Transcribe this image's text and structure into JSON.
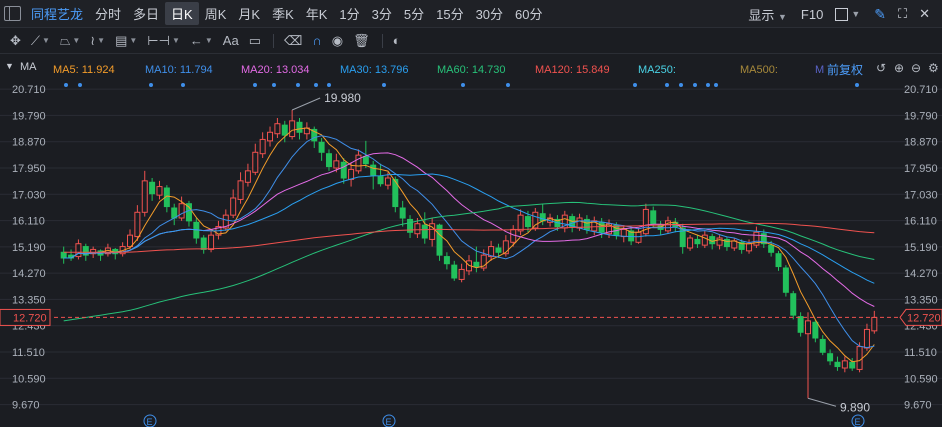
{
  "header": {
    "stock_name": "同程艺龙",
    "tabs": [
      "分时",
      "多日",
      "日K",
      "周K",
      "月K",
      "季K",
      "年K",
      "1分",
      "3分",
      "5分",
      "15分",
      "30分",
      "60分"
    ],
    "active_tab": "日K",
    "display_label": "显示",
    "f10_label": "F10"
  },
  "toolbar": {
    "icons": [
      "crosshair-icon",
      "line-tool-icon",
      "polyline-tool-icon",
      "wave-tool-icon",
      "fibonacci-tool-icon",
      "range-tool-icon",
      "arrow-tool-icon",
      "text-tool-icon",
      "comment-tool-icon",
      "eraser-icon",
      "magnet-icon",
      "eye-icon",
      "trash-icon",
      "toggle-icon"
    ],
    "text_tool": "Aa"
  },
  "ma_legend": {
    "type_label": "MA",
    "items": [
      {
        "label": "MA5: 11.924",
        "color": "#f39c2a"
      },
      {
        "label": "MA10: 11.794",
        "color": "#3f8fea"
      },
      {
        "label": "MA20: 13.034",
        "color": "#e36be6"
      },
      {
        "label": "MA30: 13.796",
        "color": "#2a9ff0"
      },
      {
        "label": "MA60: 14.730",
        "color": "#27c179"
      },
      {
        "label": "MA120: 15.849",
        "color": "#f0524f"
      },
      {
        "label": "MA250:",
        "color": "#4ad3e6"
      },
      {
        "label": "MA500:",
        "color": "#a88a3b"
      },
      {
        "label": "M",
        "color": "#5a63c8"
      }
    ],
    "adjust_label": "前复权"
  },
  "chart_data": {
    "type": "candlestick",
    "y_ticks": [
      20.71,
      19.79,
      18.87,
      17.95,
      17.03,
      16.11,
      15.19,
      14.27,
      13.35,
      12.43,
      11.51,
      10.59,
      9.67
    ],
    "ylim": [
      9.2,
      21.1
    ],
    "grid": true,
    "last_price": "12.720",
    "high_label": "19.980",
    "low_label": "9.890",
    "colors": {
      "up": "#f0524f",
      "down": "#22c05c",
      "last": "#f0524f"
    },
    "candles": [
      [
        15.0,
        14.8,
        15.2,
        14.6
      ],
      [
        14.9,
        14.8,
        15.1,
        14.7
      ],
      [
        14.85,
        15.3,
        15.45,
        14.75
      ],
      [
        15.2,
        14.9,
        15.3,
        14.7
      ],
      [
        14.95,
        15.1,
        15.2,
        14.8
      ],
      [
        15.05,
        14.9,
        15.1,
        14.7
      ],
      [
        14.95,
        15.15,
        15.3,
        14.85
      ],
      [
        15.1,
        14.95,
        15.15,
        14.75
      ],
      [
        14.95,
        15.2,
        15.35,
        14.85
      ],
      [
        15.2,
        15.6,
        15.8,
        15.1
      ],
      [
        15.55,
        16.4,
        16.65,
        15.4
      ],
      [
        16.4,
        17.5,
        17.85,
        16.25
      ],
      [
        17.45,
        17.05,
        17.6,
        16.8
      ],
      [
        17.0,
        17.3,
        17.5,
        16.85
      ],
      [
        17.25,
        16.6,
        17.35,
        16.4
      ],
      [
        16.55,
        16.2,
        16.7,
        15.95
      ],
      [
        16.2,
        16.7,
        16.95,
        16.1
      ],
      [
        16.7,
        16.1,
        16.8,
        15.9
      ],
      [
        16.05,
        15.5,
        16.2,
        15.3
      ],
      [
        15.5,
        15.1,
        15.6,
        14.95
      ],
      [
        15.1,
        15.6,
        15.8,
        15.0
      ],
      [
        15.6,
        15.9,
        16.1,
        15.45
      ],
      [
        15.85,
        16.3,
        16.5,
        15.75
      ],
      [
        16.3,
        16.9,
        17.2,
        16.2
      ],
      [
        16.85,
        17.5,
        17.8,
        16.7
      ],
      [
        17.45,
        17.85,
        18.1,
        17.3
      ],
      [
        17.8,
        18.5,
        18.8,
        17.7
      ],
      [
        18.45,
        18.95,
        19.2,
        18.3
      ],
      [
        18.9,
        19.2,
        19.4,
        18.7
      ],
      [
        19.15,
        19.5,
        19.7,
        19.0
      ],
      [
        19.45,
        19.1,
        19.6,
        18.85
      ],
      [
        19.05,
        19.6,
        19.98,
        18.95
      ],
      [
        19.55,
        19.2,
        19.7,
        18.95
      ],
      [
        19.15,
        19.35,
        19.55,
        18.95
      ],
      [
        19.3,
        18.9,
        19.4,
        18.65
      ],
      [
        18.85,
        18.5,
        19.0,
        18.2
      ],
      [
        18.45,
        18.0,
        18.6,
        17.85
      ],
      [
        17.95,
        18.2,
        18.45,
        17.8
      ],
      [
        18.15,
        17.6,
        18.3,
        17.4
      ],
      [
        17.55,
        17.9,
        18.15,
        17.3
      ],
      [
        17.85,
        18.4,
        18.6,
        17.75
      ],
      [
        18.35,
        18.1,
        18.9,
        17.95
      ],
      [
        18.05,
        17.7,
        18.2,
        17.2
      ],
      [
        17.65,
        17.4,
        18.1,
        17.3
      ],
      [
        17.35,
        17.6,
        17.8,
        17.2
      ],
      [
        17.55,
        16.6,
        17.65,
        16.4
      ],
      [
        16.55,
        16.2,
        16.8,
        15.9
      ],
      [
        16.15,
        15.7,
        16.3,
        15.5
      ],
      [
        15.65,
        16.0,
        16.2,
        15.5
      ],
      [
        15.95,
        15.5,
        16.4,
        15.3
      ],
      [
        15.45,
        16.0,
        16.2,
        15.2
      ],
      [
        15.95,
        14.9,
        16.0,
        14.7
      ],
      [
        14.85,
        14.6,
        15.0,
        14.4
      ],
      [
        14.55,
        14.1,
        14.7,
        14.0
      ],
      [
        14.05,
        14.4,
        14.6,
        13.95
      ],
      [
        14.35,
        14.7,
        14.9,
        14.2
      ],
      [
        14.65,
        14.5,
        15.2,
        14.3
      ],
      [
        14.45,
        14.9,
        15.1,
        14.35
      ],
      [
        14.85,
        15.2,
        15.4,
        14.7
      ],
      [
        15.15,
        15.0,
        15.3,
        14.8
      ],
      [
        14.95,
        15.4,
        15.6,
        14.85
      ],
      [
        15.35,
        15.8,
        15.95,
        15.2
      ],
      [
        15.75,
        16.3,
        16.5,
        15.6
      ],
      [
        16.25,
        15.9,
        16.45,
        15.7
      ],
      [
        15.85,
        16.4,
        16.55,
        15.75
      ],
      [
        16.35,
        16.1,
        16.7,
        15.95
      ],
      [
        16.05,
        16.2,
        16.35,
        15.9
      ],
      [
        16.15,
        15.9,
        16.3,
        15.75
      ],
      [
        15.85,
        16.3,
        16.45,
        15.7
      ],
      [
        16.25,
        15.9,
        16.35,
        15.7
      ],
      [
        15.85,
        16.2,
        16.35,
        15.75
      ],
      [
        16.15,
        15.8,
        16.3,
        15.65
      ],
      [
        15.75,
        16.1,
        16.25,
        15.6
      ],
      [
        16.05,
        15.7,
        16.2,
        15.5
      ],
      [
        15.65,
        16.0,
        16.15,
        15.5
      ],
      [
        15.95,
        15.6,
        16.05,
        15.45
      ],
      [
        15.55,
        15.8,
        15.95,
        15.35
      ],
      [
        15.75,
        15.4,
        15.85,
        15.25
      ],
      [
        15.35,
        15.7,
        15.85,
        15.3
      ],
      [
        15.65,
        16.5,
        16.7,
        15.55
      ],
      [
        16.45,
        16.0,
        16.6,
        15.85
      ],
      [
        15.95,
        15.8,
        16.1,
        15.6
      ],
      [
        15.75,
        16.1,
        16.25,
        15.65
      ],
      [
        16.05,
        15.9,
        16.2,
        15.7
      ],
      [
        15.85,
        15.2,
        16.0,
        14.95
      ],
      [
        15.15,
        15.5,
        15.6,
        15.05
      ],
      [
        15.45,
        15.3,
        15.6,
        15.15
      ],
      [
        15.25,
        15.6,
        15.75,
        15.15
      ],
      [
        15.55,
        15.3,
        15.65,
        15.1
      ],
      [
        15.25,
        15.5,
        15.6,
        15.1
      ],
      [
        15.45,
        15.2,
        15.55,
        15.05
      ],
      [
        15.15,
        15.4,
        15.5,
        15.05
      ],
      [
        15.35,
        15.1,
        15.45,
        14.95
      ],
      [
        15.05,
        15.3,
        15.45,
        14.95
      ],
      [
        15.25,
        15.7,
        15.9,
        15.15
      ],
      [
        15.65,
        15.3,
        15.8,
        15.15
      ],
      [
        15.25,
        15.0,
        15.4,
        14.85
      ],
      [
        14.95,
        14.5,
        15.05,
        14.35
      ],
      [
        14.45,
        13.6,
        14.55,
        13.45
      ],
      [
        13.55,
        12.8,
        13.65,
        12.65
      ],
      [
        12.75,
        12.2,
        12.9,
        12.05
      ],
      [
        12.15,
        12.6,
        12.9,
        9.89
      ],
      [
        12.55,
        12.0,
        12.65,
        11.85
      ],
      [
        11.95,
        11.5,
        12.1,
        11.4
      ],
      [
        11.45,
        11.2,
        11.6,
        11.05
      ],
      [
        11.15,
        11.0,
        11.35,
        10.85
      ],
      [
        10.95,
        11.2,
        11.35,
        10.8
      ],
      [
        11.15,
        10.95,
        11.3,
        10.85
      ],
      [
        10.9,
        11.7,
        11.85,
        10.8
      ],
      [
        11.65,
        12.3,
        12.5,
        11.55
      ],
      [
        12.25,
        12.72,
        12.95,
        12.15
      ]
    ]
  }
}
